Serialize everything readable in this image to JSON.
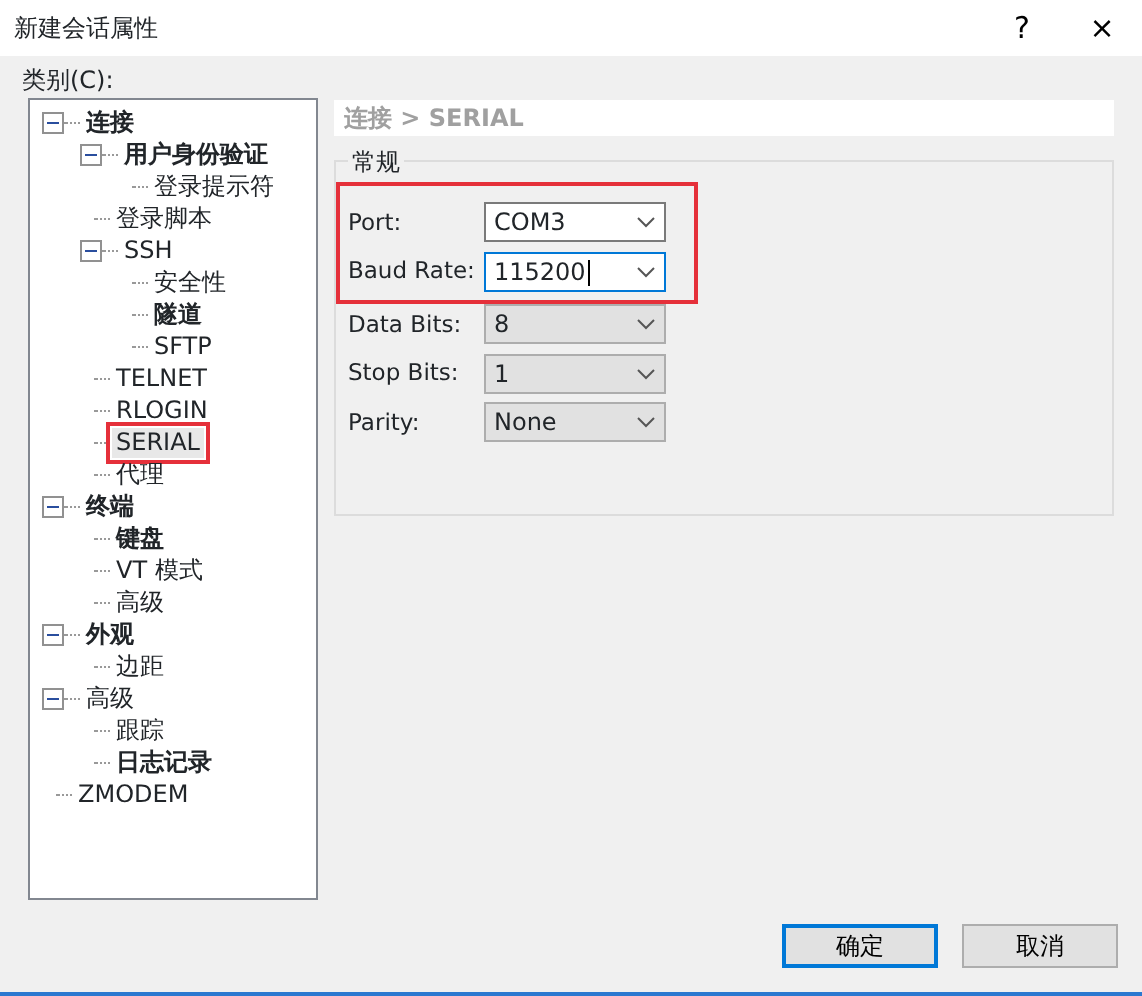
{
  "window": {
    "title": "新建会话属性",
    "help": "?",
    "close": "×"
  },
  "category_label": "类别(C):",
  "tree": [
    {
      "label": "连接",
      "bold": true,
      "expanded": true,
      "selected": false,
      "highlighted": false,
      "children": [
        {
          "label": "用户身份验证",
          "bold": true,
          "expanded": true,
          "selected": false,
          "highlighted": false,
          "children": [
            {
              "label": "登录提示符",
              "bold": false,
              "selected": false,
              "highlighted": false
            }
          ]
        },
        {
          "label": "登录脚本",
          "bold": false,
          "selected": false,
          "highlighted": false
        },
        {
          "label": "SSH",
          "bold": false,
          "expanded": true,
          "selected": false,
          "highlighted": false,
          "children": [
            {
              "label": "安全性",
              "bold": false,
              "selected": false,
              "highlighted": false
            },
            {
              "label": "隧道",
              "bold": true,
              "selected": false,
              "highlighted": false
            },
            {
              "label": "SFTP",
              "bold": false,
              "selected": false,
              "highlighted": false
            }
          ]
        },
        {
          "label": "TELNET",
          "bold": false,
          "selected": false,
          "highlighted": false
        },
        {
          "label": "RLOGIN",
          "bold": false,
          "selected": false,
          "highlighted": false
        },
        {
          "label": "SERIAL",
          "bold": false,
          "selected": true,
          "highlighted": true
        },
        {
          "label": "代理",
          "bold": false,
          "selected": false,
          "highlighted": false
        }
      ]
    },
    {
      "label": "终端",
      "bold": true,
      "expanded": true,
      "selected": false,
      "highlighted": false,
      "children": [
        {
          "label": "键盘",
          "bold": true,
          "selected": false,
          "highlighted": false
        },
        {
          "label": "VT 模式",
          "bold": false,
          "selected": false,
          "highlighted": false
        },
        {
          "label": "高级",
          "bold": false,
          "selected": false,
          "highlighted": false
        }
      ]
    },
    {
      "label": "外观",
      "bold": true,
      "expanded": true,
      "selected": false,
      "highlighted": false,
      "children": [
        {
          "label": "边距",
          "bold": false,
          "selected": false,
          "highlighted": false
        }
      ]
    },
    {
      "label": "高级",
      "bold": false,
      "expanded": true,
      "selected": false,
      "highlighted": false,
      "children": [
        {
          "label": "跟踪",
          "bold": false,
          "selected": false,
          "highlighted": false
        },
        {
          "label": "日志记录",
          "bold": true,
          "selected": false,
          "highlighted": false
        }
      ]
    },
    {
      "label": "ZMODEM",
      "bold": false,
      "selected": false,
      "highlighted": false
    }
  ],
  "breadcrumb": "连接 > SERIAL",
  "group": {
    "title": "常规",
    "sections": [
      {
        "highlighted": true,
        "fields": [
          {
            "label": "Port:",
            "value": "COM3",
            "kind": "editable",
            "focused": false
          },
          {
            "label": "Baud Rate:",
            "value": "115200",
            "kind": "editable",
            "focused": true
          }
        ]
      },
      {
        "highlighted": false,
        "fields": [
          {
            "label": "Data Bits:",
            "value": "8",
            "kind": "dropdown",
            "focused": false
          },
          {
            "label": "Stop Bits:",
            "value": "1",
            "kind": "dropdown",
            "focused": false
          },
          {
            "label": "Parity:",
            "value": "None",
            "kind": "dropdown",
            "focused": false
          }
        ]
      }
    ]
  },
  "buttons": [
    {
      "label": "确定",
      "default": true
    },
    {
      "label": "取消",
      "default": false
    }
  ]
}
